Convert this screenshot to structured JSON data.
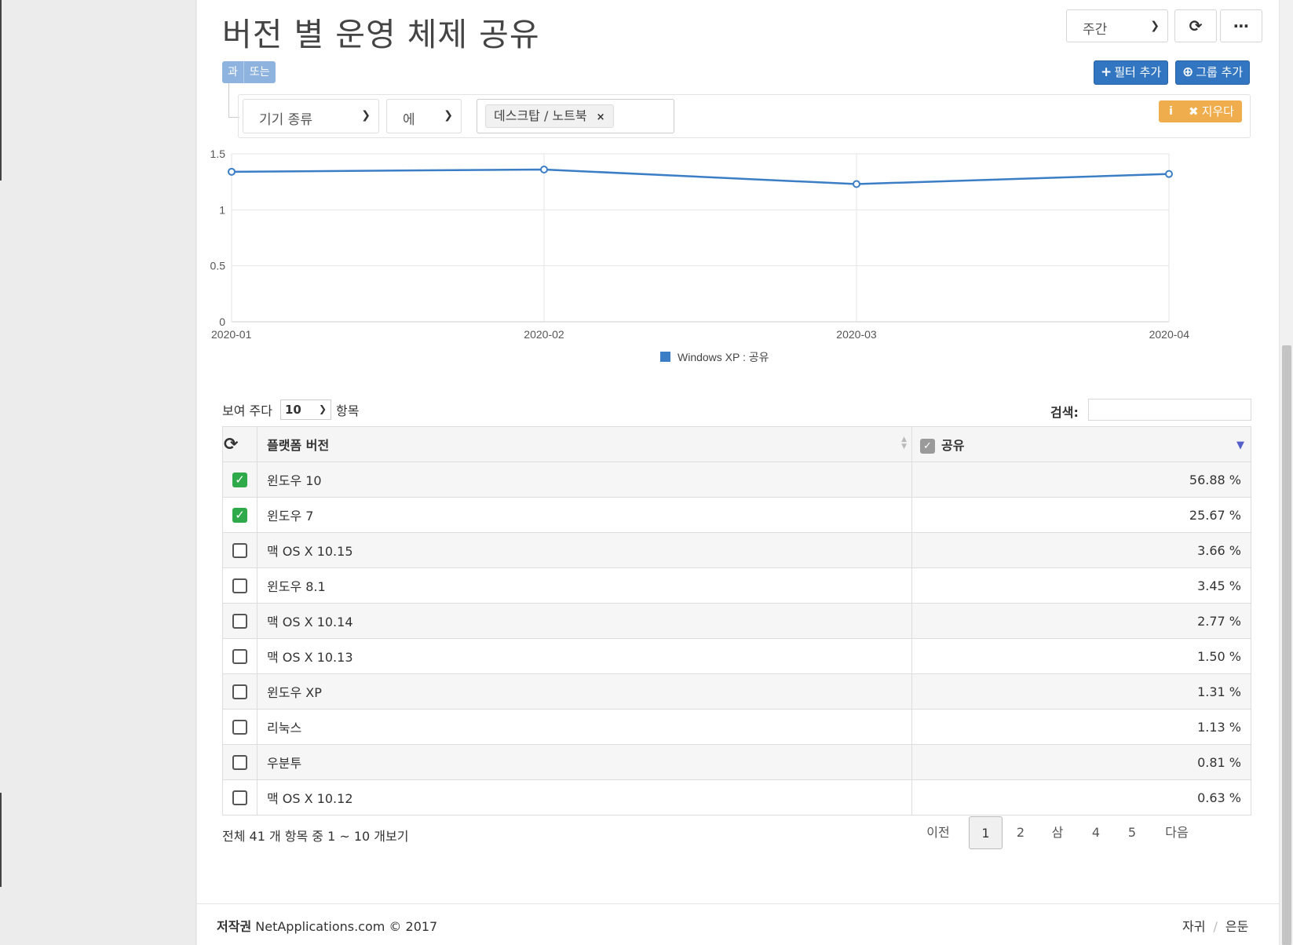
{
  "page": {
    "title": "버전 별 운영 체제 공유"
  },
  "toolbar": {
    "period_value": "주간",
    "refresh_icon": "refresh-icon",
    "more_icon": "ellipsis-icon"
  },
  "filter": {
    "logic_and": "과",
    "logic_or": "또는",
    "add_filter_label": "필터 추가",
    "add_group_label": "그룹 추가",
    "field_value": "기기 종류",
    "operator_value": "에",
    "tag_value": "데스크탑 / 노트북",
    "tag_remove": "×",
    "clear_label": "지우다",
    "info_icon": "info-icon"
  },
  "chart_data": {
    "type": "line",
    "x": [
      "2020-01",
      "2020-02",
      "2020-03",
      "2020-04"
    ],
    "series": [
      {
        "name": "Windows XP : 공유",
        "values": [
          1.34,
          1.36,
          1.23,
          1.32
        ],
        "color": "#3b7ec6"
      }
    ],
    "y_ticks": [
      "0",
      "0.5",
      "1",
      "1.5"
    ],
    "ylim": [
      0,
      1.5
    ],
    "grid": true,
    "legend": "bottom-center",
    "legend_label": "Windows XP : 공유"
  },
  "table": {
    "show_label": "보여 주다",
    "page_size": "10",
    "entries_label": "항목",
    "search_label": "검색:",
    "search_value": "",
    "columns": {
      "name": "플랫폼 버전",
      "share": "공유"
    },
    "rows": [
      {
        "name": "윈도우 10",
        "share": "56.88 %",
        "checked": true
      },
      {
        "name": "윈도우 7",
        "share": "25.67 %",
        "checked": true
      },
      {
        "name": "맥 OS X 10.15",
        "share": "3.66 %",
        "checked": false
      },
      {
        "name": "윈도우 8.1",
        "share": "3.45 %",
        "checked": false
      },
      {
        "name": "맥 OS X 10.14",
        "share": "2.77 %",
        "checked": false
      },
      {
        "name": "맥 OS X 10.13",
        "share": "1.50 %",
        "checked": false
      },
      {
        "name": "윈도우 XP",
        "share": "1.31 %",
        "checked": false
      },
      {
        "name": "리눅스",
        "share": "1.13 %",
        "checked": false
      },
      {
        "name": "우분투",
        "share": "0.81 %",
        "checked": false
      },
      {
        "name": "맥 OS X 10.12",
        "share": "0.63 %",
        "checked": false
      }
    ],
    "info": "전체 41 개 항목 중 1 ~ 10 개보기"
  },
  "pagination": {
    "prev": "이전",
    "pages": [
      "1",
      "2",
      "삼",
      "4",
      "5"
    ],
    "active": "1",
    "next": "다음"
  },
  "footer": {
    "copyright_label": "저작권",
    "copyright_text": "NetApplications.com © 2017",
    "link1": "자귀",
    "separator": "/",
    "link2": "은둔"
  },
  "colors": {
    "primary": "#3276c1",
    "warning": "#f0ad4e",
    "checked": "#2eaa4b",
    "line": "#3b7ec6"
  }
}
